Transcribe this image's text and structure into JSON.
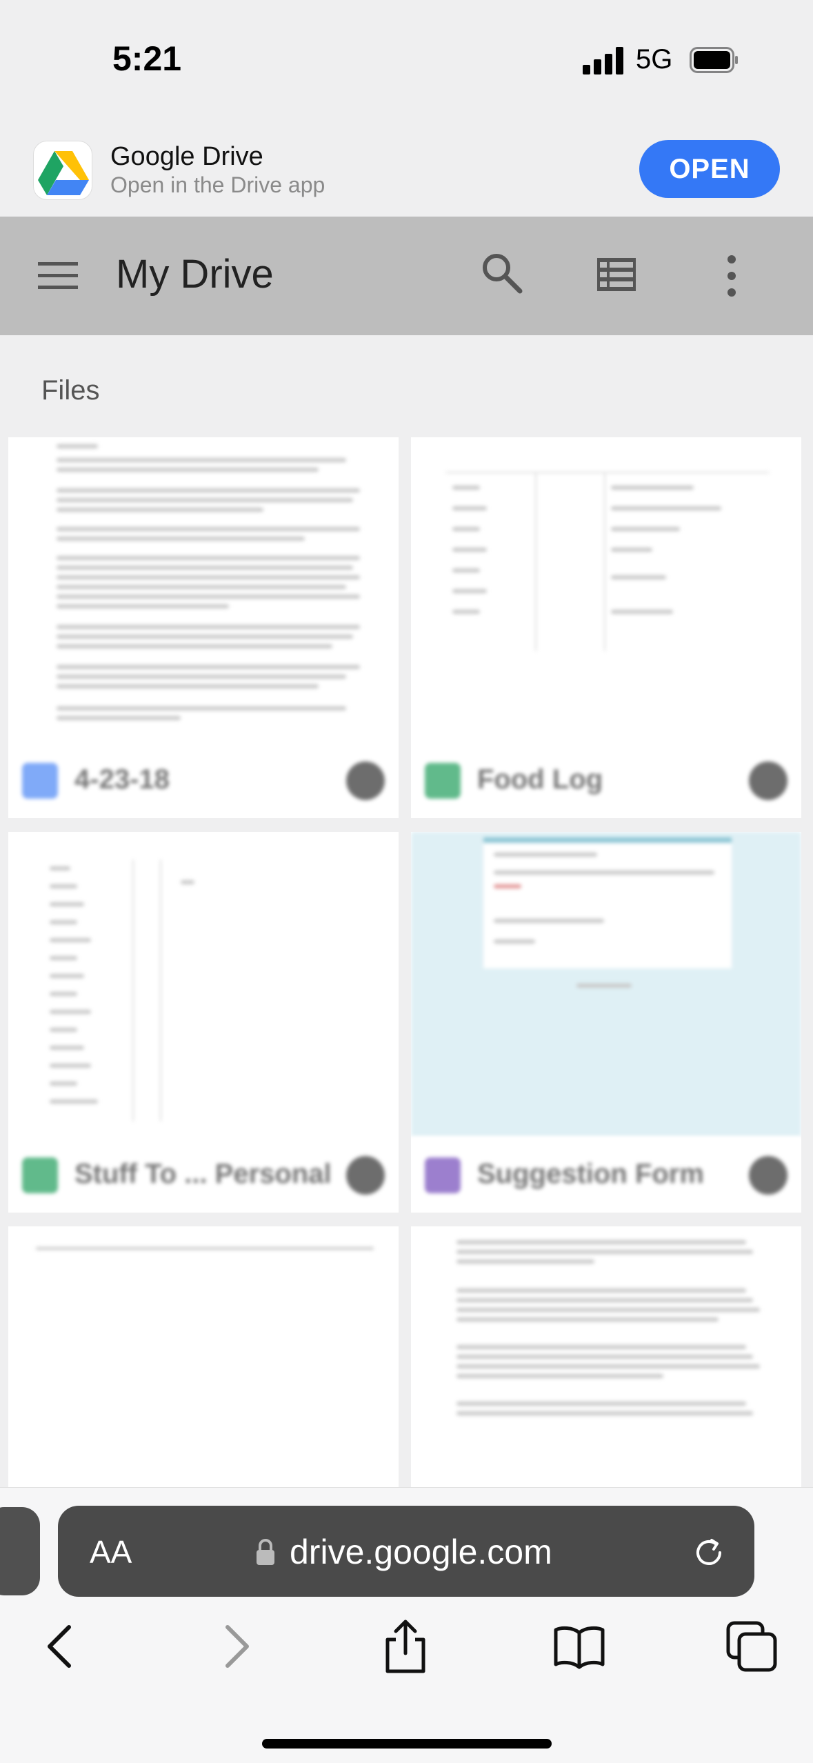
{
  "status_bar": {
    "time": "5:21",
    "network": "5G"
  },
  "app_banner": {
    "name": "Google Drive",
    "subtitle": "Open in the Drive app",
    "open_label": "OPEN"
  },
  "header": {
    "title": "My Drive"
  },
  "files": {
    "section_label": "Files",
    "items": [
      {
        "name": "4-23-18",
        "type_icon": "docs-icon",
        "color": "#4a86f5"
      },
      {
        "name": "Food Log",
        "type_icon": "sheets-icon",
        "color": "#1e9d5a"
      },
      {
        "name": "Stuff To ... Personal",
        "type_icon": "sheets-icon",
        "color": "#1e9d5a"
      },
      {
        "name": "Suggestion Form",
        "type_icon": "forms-icon",
        "color": "#7248b9"
      }
    ]
  },
  "safari": {
    "aa_label": "AA",
    "url": "drive.google.com"
  },
  "colors": {
    "accent": "#3478f6",
    "header_bg": "#bdbdbd"
  }
}
